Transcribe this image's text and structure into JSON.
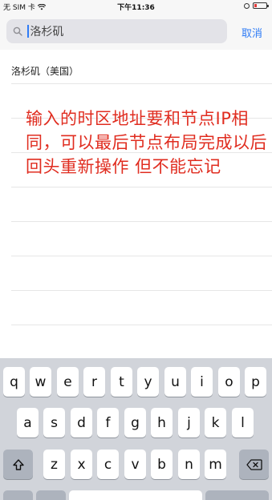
{
  "status_bar": {
    "carrier": "无 SIM 卡",
    "time": "下午11:36"
  },
  "search": {
    "value": "洛杉矶",
    "cancel_label": "取消"
  },
  "results": [
    {
      "label": "洛杉矶（美国）"
    }
  ],
  "annotation": "输入的时区地址要和节点IP相同，可以最后节点布局完成以后回头重新操作 但不能忘记",
  "keyboard": {
    "row1": [
      "q",
      "w",
      "e",
      "r",
      "t",
      "y",
      "u",
      "i",
      "o",
      "p"
    ],
    "row2": [
      "a",
      "s",
      "d",
      "f",
      "g",
      "h",
      "j",
      "k",
      "l"
    ],
    "row3": [
      "z",
      "x",
      "c",
      "v",
      "b",
      "n",
      "m"
    ]
  }
}
